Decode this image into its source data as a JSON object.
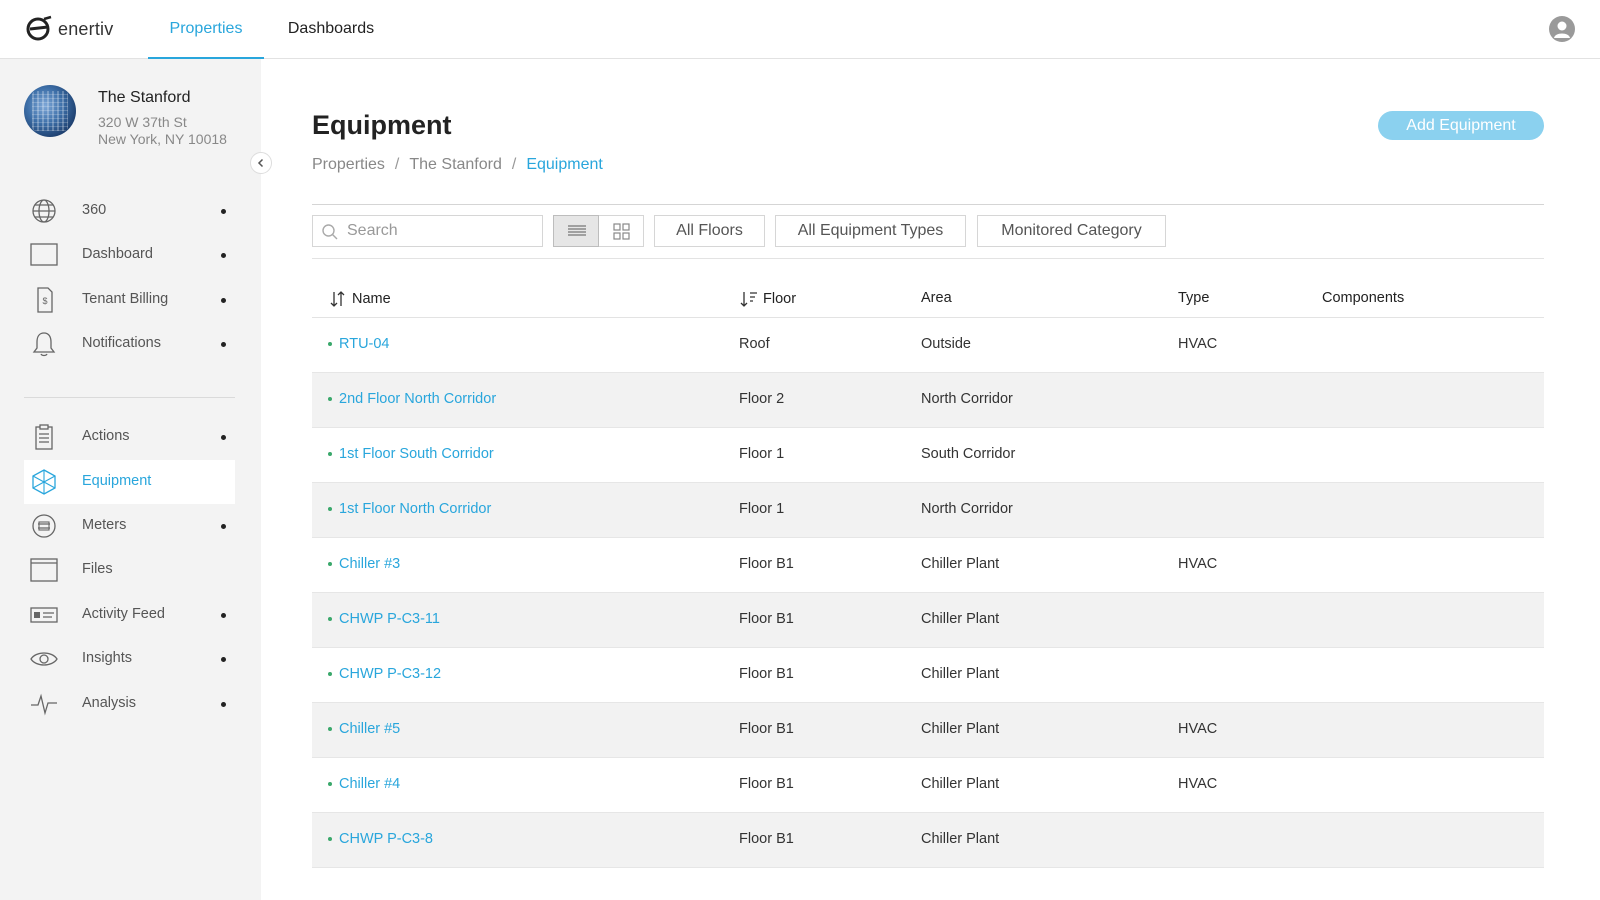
{
  "app": {
    "logo_text": "enertiv"
  },
  "topnav": {
    "tabs": [
      {
        "label": "Properties"
      },
      {
        "label": "Dashboards"
      }
    ]
  },
  "property": {
    "name": "The Stanford",
    "address_line1": "320 W 37th St",
    "address_line2": "New York, NY 10018"
  },
  "sidebar": {
    "items": [
      {
        "label": "360",
        "icon": "globe-icon",
        "dot": true
      },
      {
        "label": "Dashboard",
        "icon": "monitor-icon",
        "dot": true
      },
      {
        "label": "Tenant Billing",
        "icon": "bill-icon",
        "dot": true
      },
      {
        "label": "Notifications",
        "icon": "bell-icon",
        "dot": true
      },
      {
        "label": "Actions",
        "icon": "clipboard-icon",
        "dot": true
      },
      {
        "label": "Equipment",
        "icon": "equipment-cube-icon",
        "dot": false,
        "active": true
      },
      {
        "label": "Meters",
        "icon": "meter-icon",
        "dot": true
      },
      {
        "label": "Files",
        "icon": "files-icon",
        "dot": false
      },
      {
        "label": "Activity Feed",
        "icon": "activity-card-icon",
        "dot": true
      },
      {
        "label": "Insights",
        "icon": "eye-icon",
        "dot": true
      },
      {
        "label": "Analysis",
        "icon": "pulse-icon",
        "dot": true
      }
    ]
  },
  "page": {
    "title": "Equipment",
    "breadcrumb": [
      "Properties",
      "The Stanford",
      "Equipment"
    ],
    "breadcrumb_sep": "/",
    "add_button": "Add Equipment"
  },
  "toolbar": {
    "search_placeholder": "Search",
    "filters": [
      "All Floors",
      "All Equipment Types",
      "Monitored Category"
    ]
  },
  "table": {
    "columns": [
      "Name",
      "Floor",
      "Area",
      "Type",
      "Components"
    ],
    "rows": [
      {
        "name": "RTU-04",
        "floor": "Roof",
        "area": "Outside",
        "type": "HVAC",
        "components": ""
      },
      {
        "name": "2nd Floor North Corridor",
        "floor": "Floor 2",
        "area": "North Corridor",
        "type": "",
        "components": ""
      },
      {
        "name": "1st Floor South Corridor",
        "floor": "Floor 1",
        "area": "South Corridor",
        "type": "",
        "components": ""
      },
      {
        "name": "1st Floor North Corridor",
        "floor": "Floor 1",
        "area": "North Corridor",
        "type": "",
        "components": ""
      },
      {
        "name": "Chiller #3",
        "floor": "Floor B1",
        "area": "Chiller Plant",
        "type": "HVAC",
        "components": ""
      },
      {
        "name": "CHWP P-C3-11",
        "floor": "Floor B1",
        "area": "Chiller Plant",
        "type": "",
        "components": ""
      },
      {
        "name": "CHWP P-C3-12",
        "floor": "Floor B1",
        "area": "Chiller Plant",
        "type": "",
        "components": ""
      },
      {
        "name": "Chiller #5",
        "floor": "Floor B1",
        "area": "Chiller Plant",
        "type": "HVAC",
        "components": ""
      },
      {
        "name": "Chiller #4",
        "floor": "Floor B1",
        "area": "Chiller Plant",
        "type": "HVAC",
        "components": ""
      },
      {
        "name": "CHWP P-C3-8",
        "floor": "Floor B1",
        "area": "Chiller Plant",
        "type": "",
        "components": ""
      }
    ]
  },
  "colors": {
    "accent": "#29a6dc",
    "button": "#8bd1ef",
    "sidebar_bg": "#f3f3f3",
    "status_dot": "#3aa86b"
  }
}
